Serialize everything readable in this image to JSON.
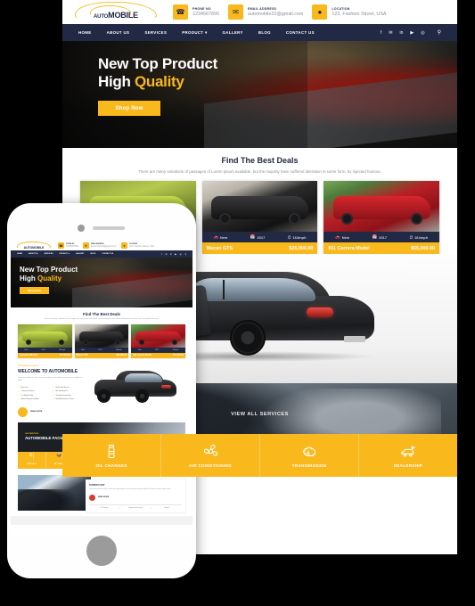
{
  "brand": {
    "logo_prefix": "AUTO",
    "logo_suffix": "MOBILE"
  },
  "header": {
    "contacts": [
      {
        "label": "PHONE NO",
        "value": "1234567890",
        "icon": "phone-icon"
      },
      {
        "label": "EMAIL ADDRESS",
        "value": "automobile22@gmail.com",
        "icon": "envelope-icon"
      },
      {
        "label": "LOCATION",
        "value": "123, Fashion Street, USA",
        "icon": "map-pin-icon"
      }
    ],
    "nav": [
      "HOME",
      "ABOUT US",
      "SERVICES",
      "PRODUCT ▾",
      "GALLERY",
      "BLOG",
      "CONTACT US"
    ],
    "social": [
      "f",
      "✉",
      "in",
      "▶",
      "◎"
    ],
    "search_icon": "search-icon"
  },
  "hero": {
    "line1": "New Top Product",
    "line2_plain": "High ",
    "line2_accent": "Quality",
    "cta": "Shop Now"
  },
  "deals": {
    "title": "Find The Best Deals",
    "subtitle": "There are many variations of passages of Lorem Ipsum available,\nbut the majority have suffered alteration in some form, by injected humour.",
    "meta_labels": {
      "condition": "New",
      "year": "2017",
      "speed": "164mph"
    },
    "cards": [
      {
        "name": "Panamera Models",
        "price": "$45,000.00",
        "color": "green"
      },
      {
        "name": "Macan GTS",
        "price": "$25,000.00",
        "color": "black"
      },
      {
        "name": "911 Carrera Model",
        "price": "$55,000.00",
        "color": "red"
      }
    ]
  },
  "services": {
    "view_all": "VIEW ALL SERVICES",
    "items": [
      {
        "label": "OIL CHANGES",
        "icon": "oil-bottle-icon"
      },
      {
        "label": "AIR CONDITIONING",
        "icon": "air-fan-icon"
      },
      {
        "label": "TRANSMISSION",
        "icon": "engine-icon"
      },
      {
        "label": "DEALERSHIP",
        "icon": "car-key-icon"
      }
    ]
  },
  "mobile": {
    "welcome": {
      "eyebrow": "AUTOMOBILE SHOP",
      "title": "WELCOME TO AUTOMOBILE",
      "text": "Lorem ipsum dolor sit amet, consectetur adipiscing elit sed do eiusmod tempor incididunt ut labore.",
      "features": [
        "Best Price",
        "Multi Level Service",
        "Customer Services",
        "We Standing For",
        "Car Shop Facility",
        "Transport Inspections",
        "Special Request Candles",
        "Best Maintenance Center"
      ],
      "cta": "READ MORE"
    },
    "facilities": {
      "eyebrow": "OUR SERVICES",
      "title": "AUTOMOBILE FACILITIES",
      "items": [
        {
          "label": "SUPER FAST",
          "icon": "speed-icon"
        },
        {
          "label": "OIL CHANGES",
          "icon": "oil-bottle-icon"
        },
        {
          "label": "OIL CHANGES",
          "icon": "lock-icon"
        },
        {
          "label": "AIR CONDITIONING",
          "icon": "air-fan-icon"
        },
        {
          "label": "TRANSMISSION",
          "icon": "engine-icon"
        },
        {
          "label": "DEALERSHIP",
          "icon": "car-key-icon"
        }
      ]
    },
    "superfast": {
      "title": "SUPER FAST",
      "text": "Lorem ipsum dolor sit amet, consectetur adipiscing elit, sed do eiusmod tempor incididunt ut labore et dolore magna aliqua.",
      "cta": "READ MORE",
      "tabs": [
        "Oil Changes",
        "Transmission Service",
        "Details"
      ]
    }
  }
}
